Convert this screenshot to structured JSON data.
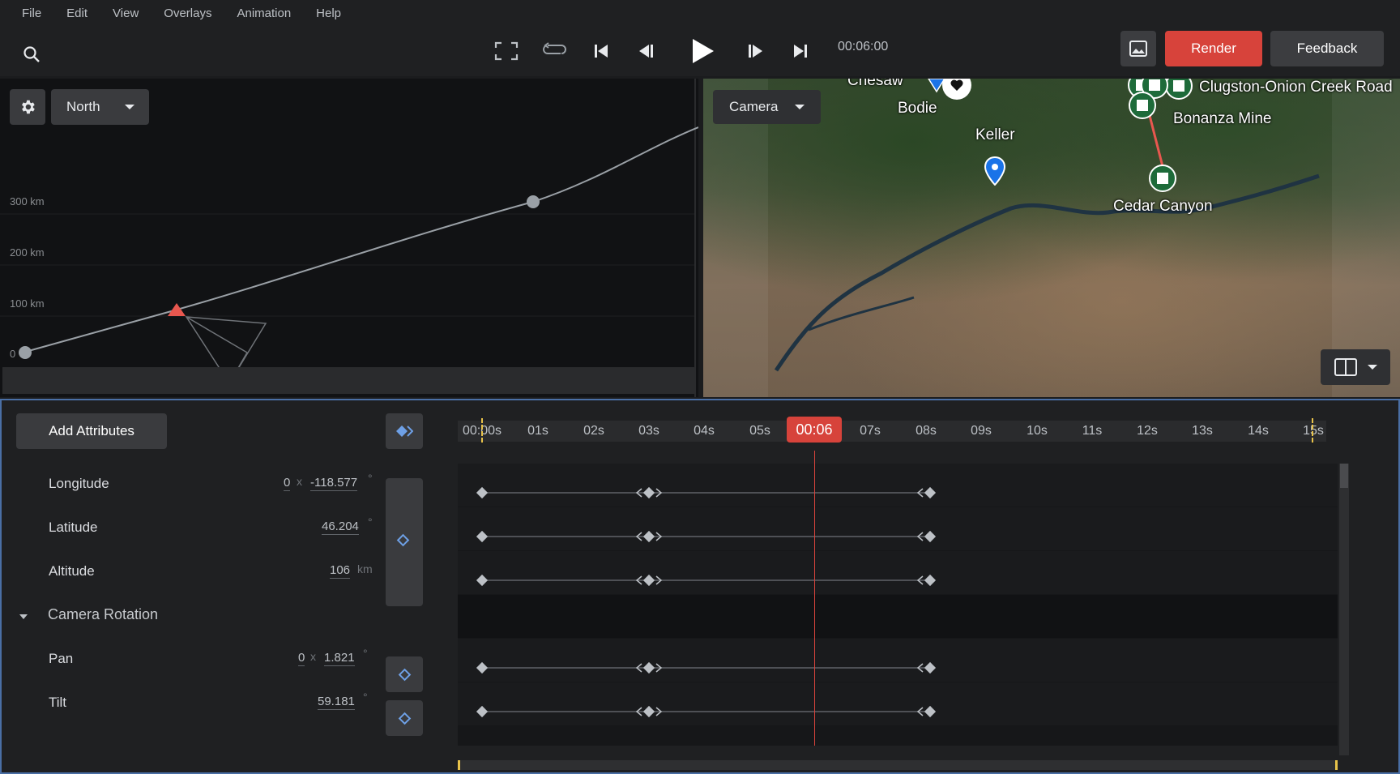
{
  "menu": [
    "File",
    "Edit",
    "View",
    "Overlays",
    "Animation",
    "Help"
  ],
  "toolbar": {
    "time": "00:06:00",
    "render_label": "Render",
    "feedback_label": "Feedback",
    "icons": [
      "search-icon",
      "fullscreen-icon",
      "loop-icon",
      "skip-start-icon",
      "step-back-icon",
      "play-icon",
      "step-forward-icon",
      "skip-end-icon",
      "image-icon"
    ]
  },
  "graph": {
    "orientation": "North",
    "y_labels": [
      "300 km",
      "200 km",
      "100 km",
      "0"
    ]
  },
  "map": {
    "camera_select": "Camera",
    "labels": {
      "chesaw": "Chesaw",
      "bodie": "Bodie",
      "keller": "Keller",
      "clugston": "Clugston-Onion Creek Road",
      "bonanza": "Bonanza Mine",
      "cedar": "Cedar Canyon"
    }
  },
  "timeline": {
    "add_attributes_label": "Add Attributes",
    "current_time": "00:06",
    "ticks": [
      "00:00s",
      "01s",
      "02s",
      "03s",
      "04s",
      "05s",
      "07s",
      "08s",
      "09s",
      "10s",
      "11s",
      "12s",
      "13s",
      "14s",
      "15s"
    ],
    "rows": {
      "longitude": {
        "label": "Longitude",
        "mult": "0",
        "value": "-118.577",
        "unit": "°"
      },
      "latitude": {
        "label": "Latitude",
        "value": "46.204",
        "unit": "°"
      },
      "altitude": {
        "label": "Altitude",
        "value": "106",
        "unit": "km"
      },
      "camera_rotation": {
        "label": "Camera Rotation"
      },
      "pan": {
        "label": "Pan",
        "mult": "0",
        "value": "1.821",
        "unit": "°"
      },
      "tilt": {
        "label": "Tilt",
        "value": "59.181",
        "unit": "°"
      }
    },
    "x_sep": "x"
  },
  "colors": {
    "accent_red": "#d7433b",
    "keyframe_blue": "#6ea0e6",
    "marker_green": "#1e6b3a"
  }
}
